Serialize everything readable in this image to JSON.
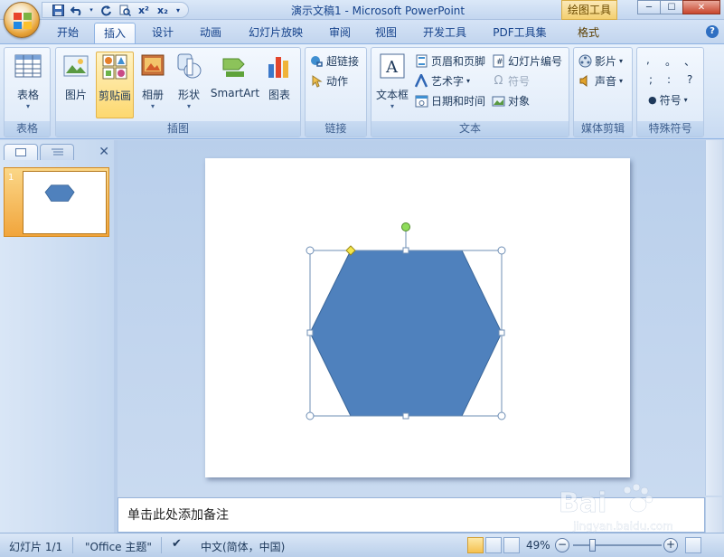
{
  "window": {
    "title": "演示文稿1 - Microsoft PowerPoint",
    "context_title": "绘图工具",
    "window_buttons": [
      "─",
      "☐",
      "✕"
    ]
  },
  "tabs": [
    "开始",
    "插入",
    "设计",
    "动画",
    "幻灯片放映",
    "审阅",
    "视图",
    "开发工具",
    "PDF工具集",
    "格式"
  ],
  "active_tab": "插入",
  "ribbon": {
    "groups": {
      "table": {
        "label": "表格",
        "buttons": [
          {
            "label": "表格",
            "icon": "table-icon"
          }
        ]
      },
      "illustrations": {
        "label": "插图",
        "buttons": [
          {
            "label": "图片",
            "icon": "picture-icon"
          },
          {
            "label": "剪贴画",
            "icon": "clipart-icon",
            "selected": true
          },
          {
            "label": "相册",
            "icon": "photo-album-icon"
          },
          {
            "label": "形状",
            "icon": "shapes-icon"
          },
          {
            "label": "SmartArt",
            "icon": "smartart-icon"
          },
          {
            "label": "图表",
            "icon": "chart-icon"
          }
        ]
      },
      "links": {
        "label": "链接",
        "buttons": [
          {
            "label": "超链接",
            "icon": "hyperlink-icon"
          },
          {
            "label": "动作",
            "icon": "action-icon"
          }
        ]
      },
      "text": {
        "label": "文本",
        "buttons": [
          {
            "label": "文本框",
            "icon": "textbox-icon"
          },
          {
            "label": "页眉和页脚",
            "icon": "header-footer-icon"
          },
          {
            "label": "艺术字",
            "icon": "wordart-icon"
          },
          {
            "label": "日期和时间",
            "icon": "date-time-icon"
          },
          {
            "label": "幻灯片编号",
            "icon": "slide-number-icon"
          },
          {
            "label": "符号",
            "icon": "omega-icon",
            "disabled": true
          },
          {
            "label": "对象",
            "icon": "object-icon"
          }
        ]
      },
      "media": {
        "label": "媒体剪辑",
        "buttons": [
          {
            "label": "影片",
            "icon": "movie-icon"
          },
          {
            "label": "声音",
            "icon": "sound-icon"
          }
        ]
      },
      "special_symbols": {
        "label": "特殊符号",
        "symbols": [
          ",",
          "。",
          "、",
          ";",
          ":",
          "?"
        ],
        "button_label": "符号"
      }
    }
  },
  "slide_panel": {
    "close_glyph": "✕",
    "slides": [
      {
        "number": "1",
        "shape": "hexagon"
      }
    ]
  },
  "slide": {
    "shape": "hexagon",
    "fill_color": "#4f81bd",
    "selection_color": "#6f8fb5",
    "rotate_handle_color": "#8fdc5b",
    "adjust_handle_color": "#f5e64b"
  },
  "notes": {
    "placeholder": "单击此处添加备注"
  },
  "status": {
    "slide_info": "幻灯片 1/1",
    "theme": "\"Office 主题\"",
    "language": "中文(简体，中国)",
    "zoom": "49%",
    "zoom_level": 0.49
  },
  "watermark": {
    "brand": "Bai",
    "sub": "jingyan.baidu.com"
  }
}
